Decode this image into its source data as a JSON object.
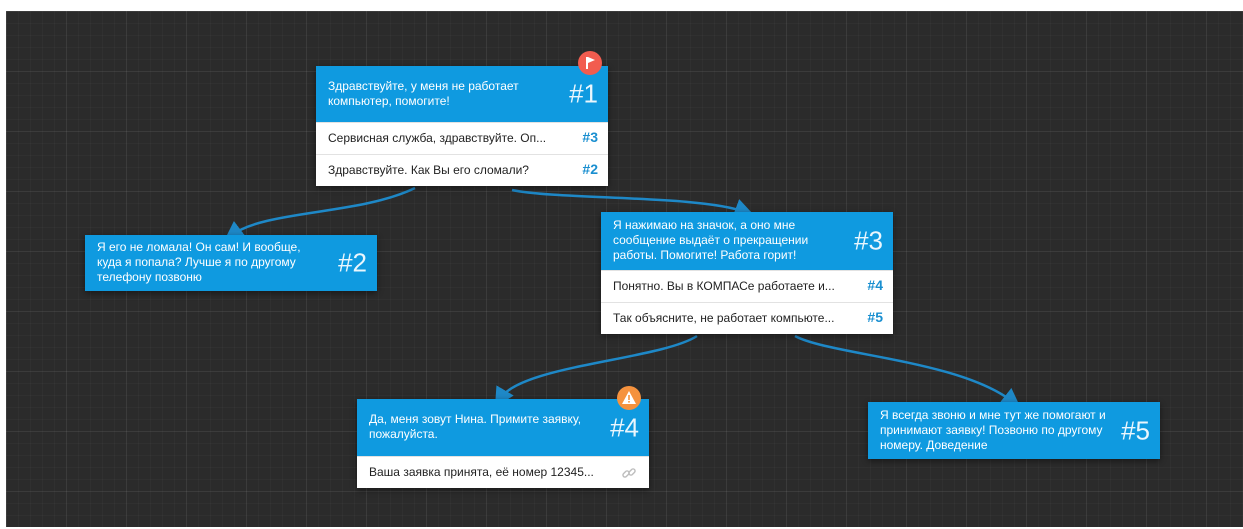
{
  "nodes": {
    "n1": {
      "text": "Здравствуйте, у меня не работает компьютер, помогите!",
      "number": "#1",
      "answers": [
        {
          "text": "Сервисная служба, здравствуйте. Оп...",
          "target": "#3"
        },
        {
          "text": "Здравствуйте. Как Вы его сломали?",
          "target": "#2"
        }
      ]
    },
    "n2": {
      "text": "Я его не ломала! Он сам! И вообще, куда я попала? Лучше я по другому телефону позвоню",
      "number": "#2"
    },
    "n3": {
      "text": "Я нажимаю на значок, а оно мне сообщение выдаёт о прекращении работы. Помогите! Работа горит!",
      "number": "#3",
      "answers": [
        {
          "text": "Понятно. Вы в КОМПАСе работаете и...",
          "target": "#4"
        },
        {
          "text": "Так объясните, не работает компьюте...",
          "target": "#5"
        }
      ]
    },
    "n4": {
      "text": "Да, меня зовут Нина. Примите заявку, пожалуйста.",
      "number": "#4",
      "answers": [
        {
          "text": "Ваша заявка принята, её номер 12345..."
        }
      ]
    },
    "n5": {
      "text": "Я всегда звоню и мне тут же помогают и принимают заявку! Позвоню по другому номеру. Доведение",
      "number": "#5"
    }
  },
  "icons": {
    "start": "flag-icon",
    "warning": "warning-icon",
    "end": "link-icon"
  },
  "colors": {
    "node_header": "#0f9ae0",
    "link": "#1e88c7",
    "start_badge": "#f25c4f",
    "warning_badge": "#f5923e",
    "canvas": "#2b2b2b"
  }
}
